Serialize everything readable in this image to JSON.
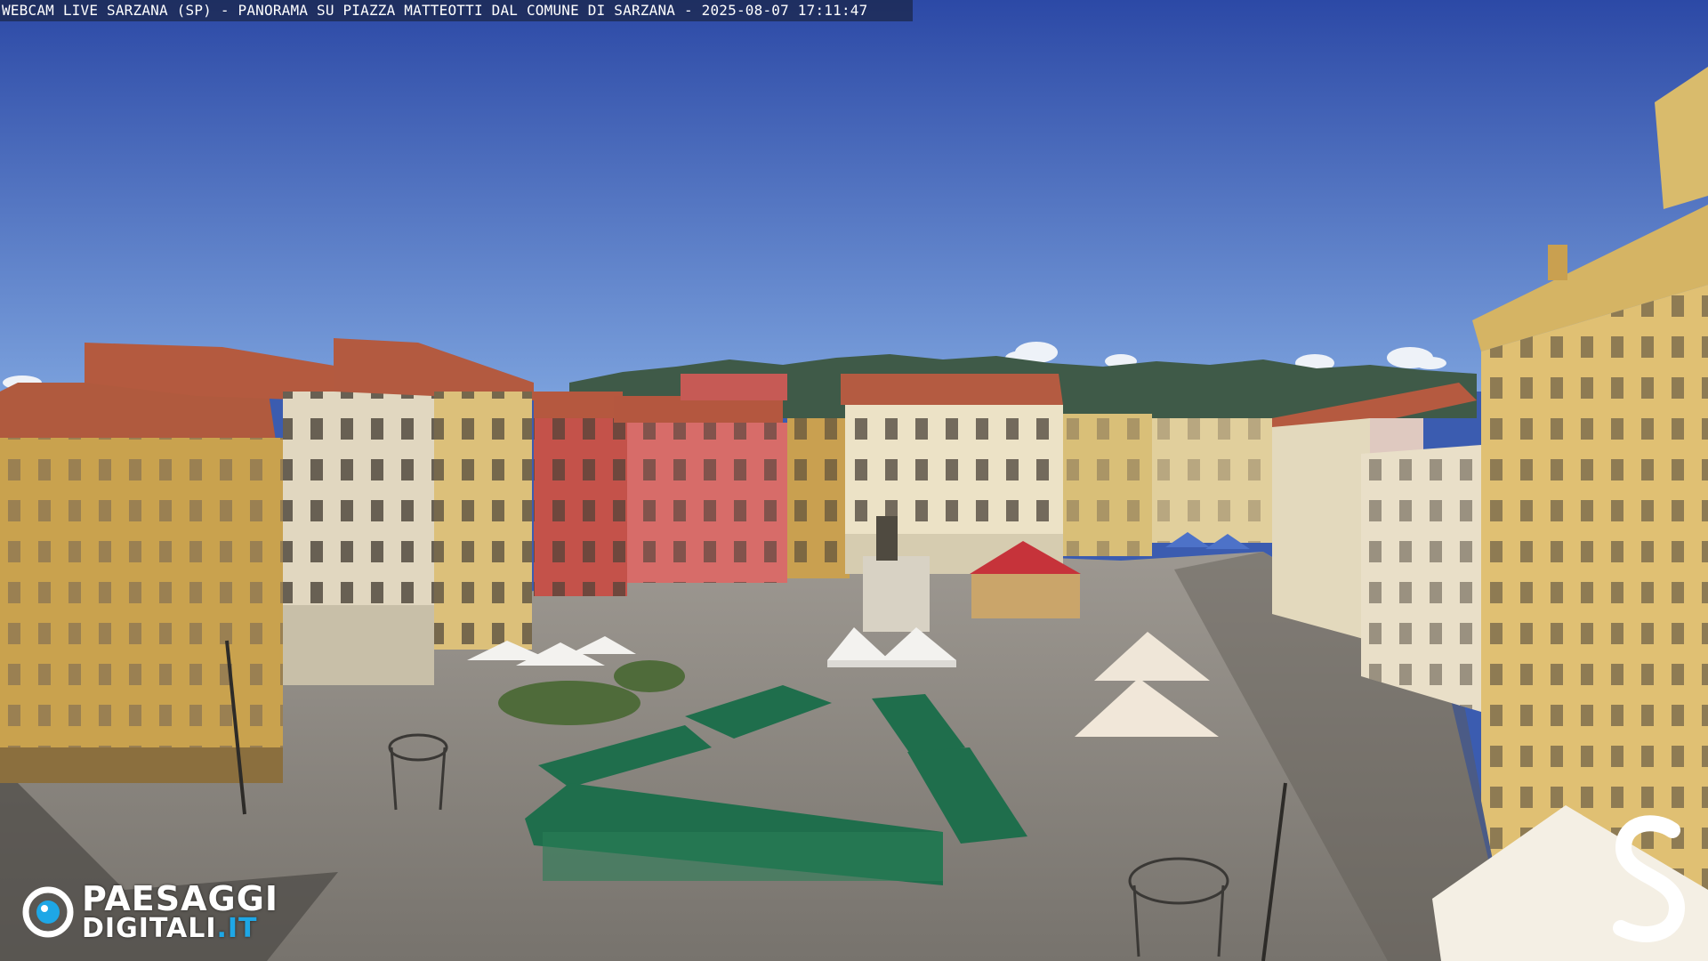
{
  "overlay": {
    "caption": "WEBCAM LIVE SARZANA (SP) - PANORAMA SU PIAZZA MATTEOTTI DAL COMUNE DI SARZANA - 2025-08-07  17:11:47"
  },
  "logo_left": {
    "line1": "PAESAGGI",
    "line2_main": "DIGITALI",
    "line2_tld": ".IT",
    "eye_icon": "eye-icon",
    "accent_color": "#1ea7e6"
  },
  "logo_right": {
    "glyph": "S"
  },
  "colors": {
    "sky_top": "#2c4aa8",
    "sky_bottom": "#6f95d6",
    "pavement": "#8a8680",
    "awning_green": "#1f6e4c",
    "ochre": "#c9a24e",
    "red_facade": "#c44f4a",
    "cream_facade": "#e8dcc0"
  }
}
